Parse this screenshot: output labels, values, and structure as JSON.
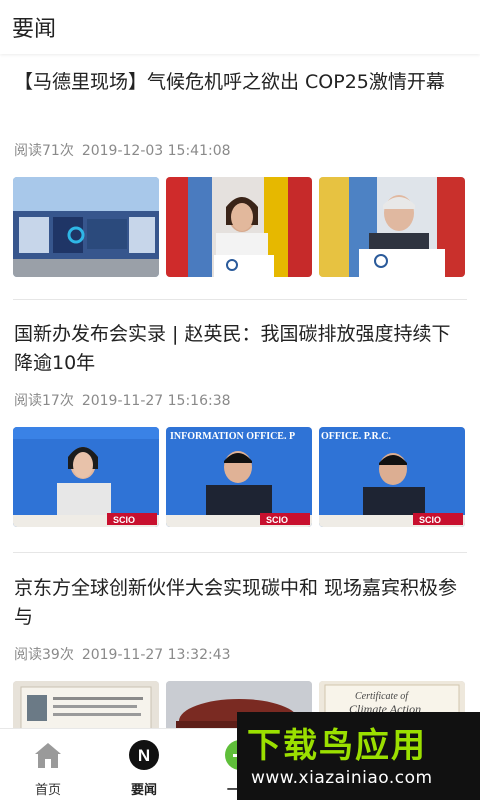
{
  "header": {
    "title": "要闻"
  },
  "articles": [
    {
      "title": "【马德里现场】气候危机呼之欲出 COP25激情开幕",
      "read_count": "阅读71次",
      "datetime": "2019-12-03 15:41:08",
      "images": [
        {
          "subject": "COP25 conference venue building exterior"
        },
        {
          "subject": "Speaker at COP25 podium with UN flags"
        },
        {
          "subject": "Elderly speaker at COP25 podium"
        }
      ]
    },
    {
      "title": "国新办发布会实录 | 赵英民：我国碳排放强度持续下降逾10年",
      "read_count": "阅读17次",
      "datetime": "2019-11-27 15:16:38",
      "images": [
        {
          "subject": "Woman speaking at SCIO press conference",
          "caption": "SCIO"
        },
        {
          "subject": "Official at SCIO press conference",
          "caption": "SCIO"
        },
        {
          "subject": "Official at SCIO press conference",
          "caption": "SCIO"
        }
      ]
    },
    {
      "title": "京东方全球创新伙伴大会实现碳中和 现场嘉宾积极参与",
      "read_count": "阅读39次",
      "datetime": "2019-11-27 13:32:43",
      "images": [
        {
          "subject": "Certificate document"
        },
        {
          "subject": "Conference venue dome"
        },
        {
          "subject": "Certificate of Climate Action"
        }
      ]
    }
  ],
  "tabbar": {
    "items": [
      {
        "label": "首页",
        "icon": "home-icon"
      },
      {
        "label": "要闻",
        "icon": "news-n-icon"
      },
      {
        "label": "一起",
        "icon": "green-plus-icon"
      }
    ]
  },
  "watermark": {
    "text": "下载鸟应用",
    "url": "www.xiazainiao.com"
  },
  "colors": {
    "accent_green": "#9be000",
    "meta_gray": "#8a8a8a",
    "scio_red": "#c8102e"
  }
}
